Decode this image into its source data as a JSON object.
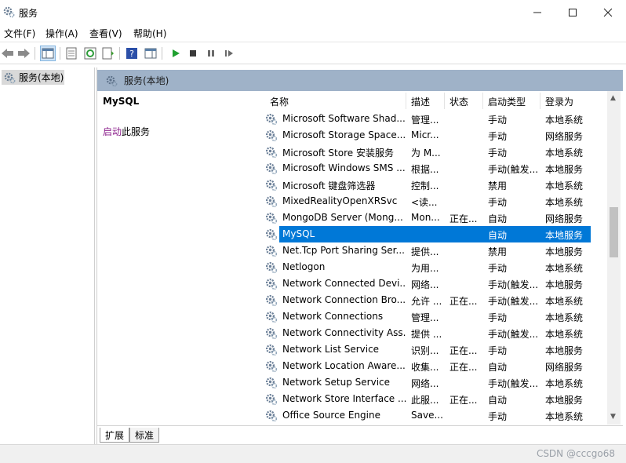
{
  "window": {
    "title": "服务"
  },
  "menu": [
    "文件(F)",
    "操作(A)",
    "查看(V)",
    "帮助(H)"
  ],
  "tree": {
    "node": "服务(本地)"
  },
  "panel": {
    "header": "服务(本地)",
    "detail_title": "MySQL",
    "action_link": "启动",
    "action_suffix": "此服务"
  },
  "columns": [
    "名称",
    "描述",
    "状态",
    "启动类型",
    "登录为"
  ],
  "rows": [
    [
      "Microsoft Software Shad...",
      "管理...",
      "",
      "手动",
      "本地系统"
    ],
    [
      "Microsoft Storage Space...",
      "Micr...",
      "",
      "手动",
      "网络服务"
    ],
    [
      "Microsoft Store 安装服务",
      "为 M...",
      "",
      "手动",
      "本地系统"
    ],
    [
      "Microsoft Windows SMS ...",
      "根据...",
      "",
      "手动(触发...",
      "本地服务"
    ],
    [
      "Microsoft 键盘筛选器",
      "控制...",
      "",
      "禁用",
      "本地系统"
    ],
    [
      "MixedRealityOpenXRSvc",
      "<读...",
      "",
      "手动",
      "本地系统"
    ],
    [
      "MongoDB Server (Mong...",
      "Mon...",
      "正在...",
      "自动",
      "网络服务"
    ],
    [
      "MySQL",
      "",
      "",
      "自动",
      "本地服务"
    ],
    [
      "Net.Tcp Port Sharing Ser...",
      "提供...",
      "",
      "禁用",
      "本地服务"
    ],
    [
      "Netlogon",
      "为用...",
      "",
      "手动",
      "本地系统"
    ],
    [
      "Network Connected Devi...",
      "网络...",
      "",
      "手动(触发...",
      "本地服务"
    ],
    [
      "Network Connection Bro...",
      "允许 ...",
      "正在...",
      "手动(触发...",
      "本地系统"
    ],
    [
      "Network Connections",
      "管理...",
      "",
      "手动",
      "本地系统"
    ],
    [
      "Network Connectivity Ass...",
      "提供 ...",
      "",
      "手动(触发...",
      "本地系统"
    ],
    [
      "Network List Service",
      "识别...",
      "正在...",
      "手动",
      "本地服务"
    ],
    [
      "Network Location Aware...",
      "收集...",
      "正在...",
      "自动",
      "网络服务"
    ],
    [
      "Network Setup Service",
      "网络...",
      "",
      "手动(触发...",
      "本地系统"
    ],
    [
      "Network Store Interface ...",
      "此服...",
      "正在...",
      "自动",
      "本地服务"
    ],
    [
      "Office  Source Engine",
      "Save...",
      "",
      "手动",
      "本地系统"
    ]
  ],
  "selected_row": 7,
  "tabs": [
    "扩展",
    "标准"
  ],
  "watermark": "CSDN @cccgo68",
  "colors": {
    "selection": "#0078d7",
    "header": "#9fb2c8",
    "link": "#8a1c8a"
  }
}
